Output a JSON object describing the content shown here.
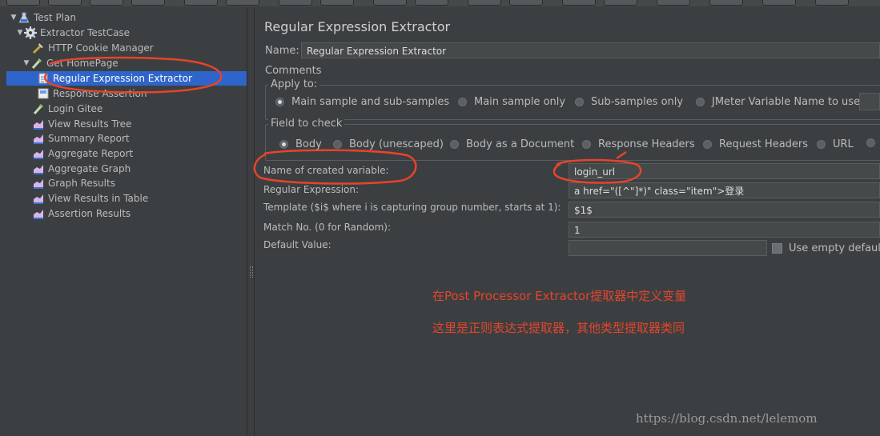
{
  "tree": {
    "items": [
      {
        "label": "Test Plan",
        "icon": "flask-icon"
      },
      {
        "label": "Extractor TestCase",
        "icon": "gear-icon"
      },
      {
        "label": "HTTP Cookie Manager",
        "icon": "wrench-icon"
      },
      {
        "label": "Get HomePage",
        "icon": "pipette-icon"
      },
      {
        "label": "Regular Expression Extractor",
        "icon": "extractor-icon"
      },
      {
        "label": "Response Assertion",
        "icon": "assertion-icon"
      },
      {
        "label": "Login Gitee",
        "icon": "pipette-icon"
      },
      {
        "label": "View Results Tree",
        "icon": "chart-icon"
      },
      {
        "label": "Summary Report",
        "icon": "chart-icon"
      },
      {
        "label": "Aggregate Report",
        "icon": "chart-icon"
      },
      {
        "label": "Aggregate Graph",
        "icon": "chart-icon"
      },
      {
        "label": "Graph Results",
        "icon": "chart-icon"
      },
      {
        "label": "View Results in Table",
        "icon": "chart-icon"
      },
      {
        "label": "Assertion Results",
        "icon": "chart-icon"
      }
    ]
  },
  "panel": {
    "title": "Regular Expression Extractor",
    "name_label": "Name:",
    "name_value": "Regular Expression Extractor",
    "comments_label": "Comments:",
    "apply_to": {
      "title": "Apply to:",
      "options": [
        "Main sample and sub-samples",
        "Main sample only",
        "Sub-samples only",
        "JMeter Variable Name to use"
      ]
    },
    "field_to_check": {
      "title": "Field to check",
      "options": [
        "Body",
        "Body (unescaped)",
        "Body as a Document",
        "Response Headers",
        "Request Headers",
        "URL"
      ]
    },
    "var_name_label": "Name of created variable:",
    "var_name_value": "login_url",
    "regex_label": "Regular Expression:",
    "regex_value": "a href=\"([^\"]*)\" class=\"item\">登录",
    "template_label": "Template ($i$ where i is capturing group number, starts at 1):",
    "template_value": "$1$",
    "match_label": "Match No. (0 for Random):",
    "match_value": "1",
    "default_label": "Default Value:",
    "default_value": "",
    "use_empty_label": "Use empty default"
  },
  "annotations": {
    "line1": "在Post Processor Extractor提取器中定义变量",
    "line2": "这里是正则表达式提取器，其他类型提取器类同",
    "color": "#e6442b"
  },
  "watermark": "https://blog.csdn.net/lelemom"
}
